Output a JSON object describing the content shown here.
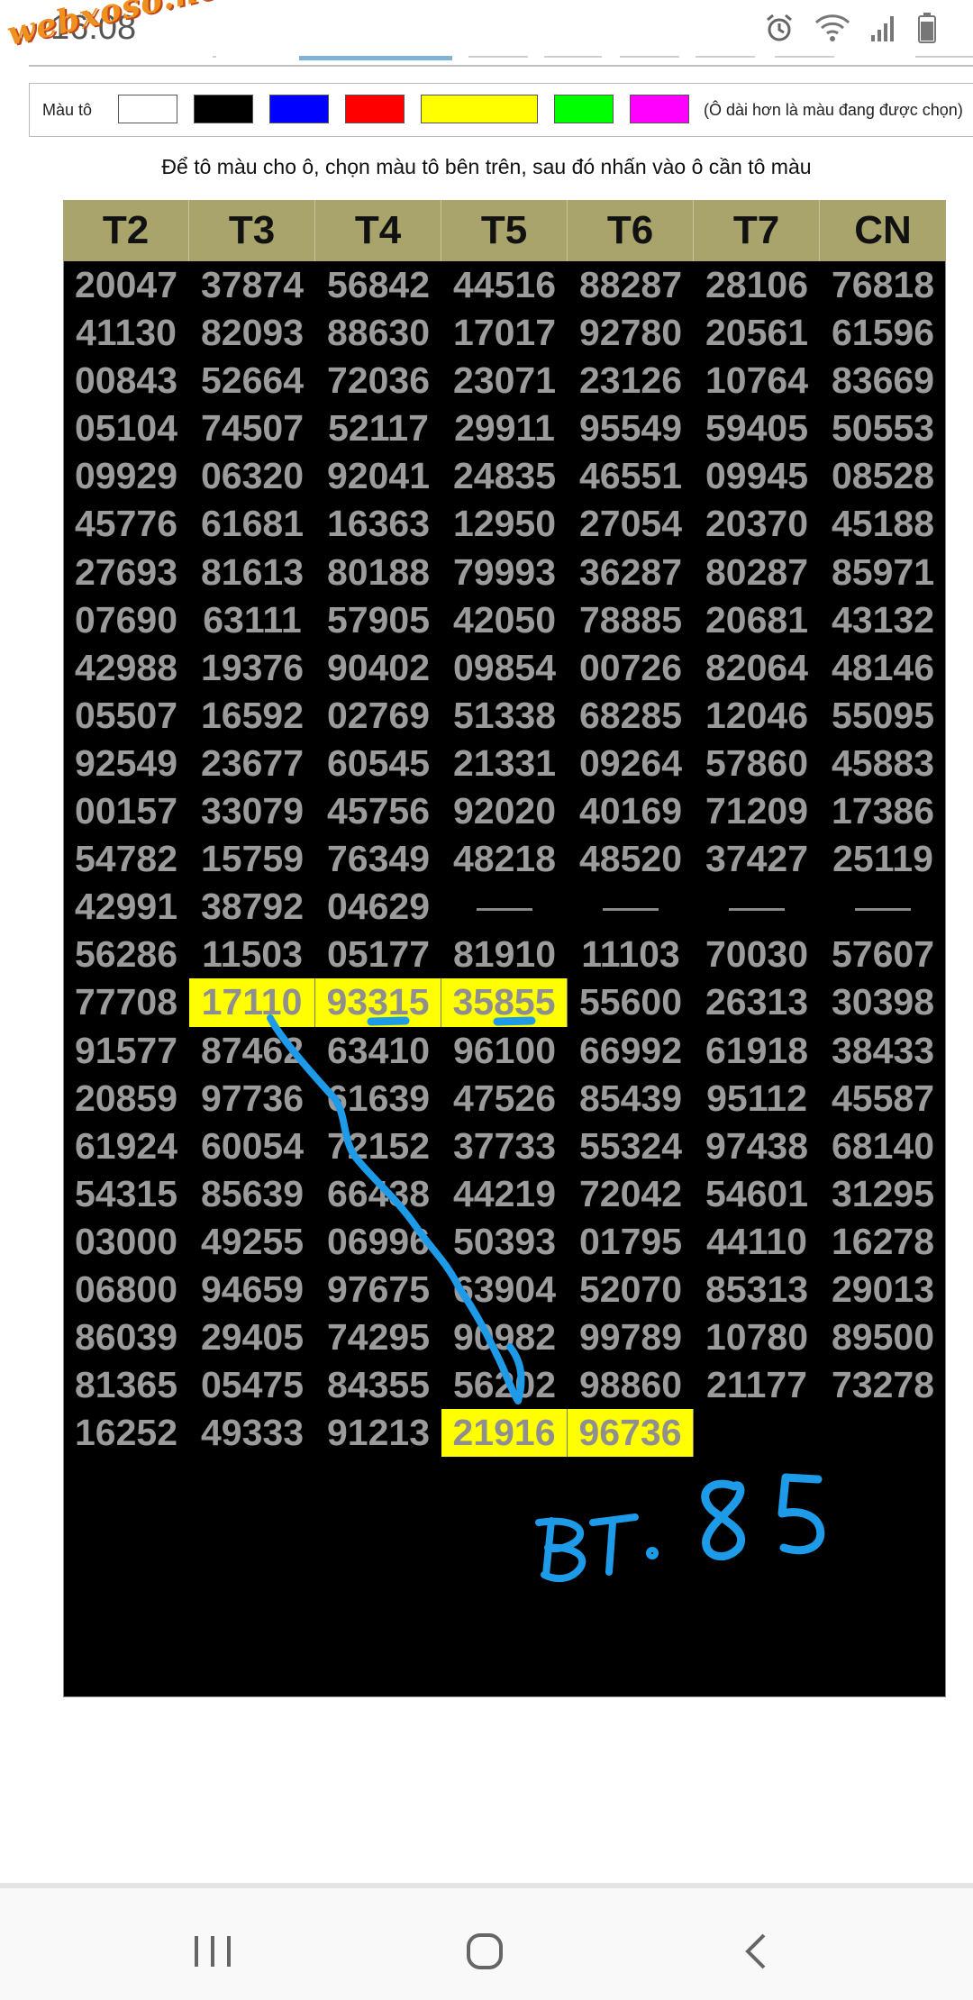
{
  "status_bar": {
    "time": "16:08",
    "watermark": "webxoso.net",
    "icons": [
      "alarm-icon",
      "wifi-icon",
      "signal-icon",
      "battery-icon"
    ]
  },
  "toolbar": {
    "label": "Màu tô",
    "swatches": [
      {
        "name": "white",
        "color": "#ffffff"
      },
      {
        "name": "black",
        "color": "#000000"
      },
      {
        "name": "blue",
        "color": "#0000ff"
      },
      {
        "name": "red",
        "color": "#ff0000"
      },
      {
        "name": "yellow",
        "color": "#ffff00",
        "selected": true
      },
      {
        "name": "green",
        "color": "#00ff00"
      },
      {
        "name": "magenta",
        "color": "#ff00ff"
      }
    ],
    "hint": "(Ô dài hơn là màu đang được chọn)"
  },
  "instruction": "Để tô màu cho ô, chọn màu tô bên trên, sau đó nhấn vào ô cần tô màu",
  "table": {
    "headers": [
      "T2",
      "T3",
      "T4",
      "T5",
      "T6",
      "T7",
      "CN"
    ],
    "rows": [
      [
        "20047",
        "37874",
        "56842",
        "44516",
        "88287",
        "28106",
        "76818"
      ],
      [
        "41130",
        "82093",
        "88630",
        "17017",
        "92780",
        "20561",
        "61596"
      ],
      [
        "00843",
        "52664",
        "72036",
        "23071",
        "23126",
        "10764",
        "83669"
      ],
      [
        "05104",
        "74507",
        "52117",
        "29911",
        "95549",
        "59405",
        "50553"
      ],
      [
        "09929",
        "06320",
        "92041",
        "24835",
        "46551",
        "09945",
        "08528"
      ],
      [
        "45776",
        "61681",
        "16363",
        "12950",
        "27054",
        "20370",
        "45188"
      ],
      [
        "27693",
        "81613",
        "80188",
        "79993",
        "36287",
        "80287",
        "85971"
      ],
      [
        "07690",
        "63111",
        "57905",
        "42050",
        "78885",
        "20681",
        "43132"
      ],
      [
        "42988",
        "19376",
        "90402",
        "09854",
        "00726",
        "82064",
        "48146"
      ],
      [
        "05507",
        "16592",
        "02769",
        "51338",
        "68285",
        "12046",
        "55095"
      ],
      [
        "92549",
        "23677",
        "60545",
        "21331",
        "09264",
        "57860",
        "45883"
      ],
      [
        "00157",
        "33079",
        "45756",
        "92020",
        "40169",
        "71209",
        "17386"
      ],
      [
        "54782",
        "15759",
        "76349",
        "48218",
        "48520",
        "37427",
        "25119"
      ],
      [
        "42991",
        "38792",
        "04629",
        "-",
        "-",
        "-",
        "-"
      ],
      [
        "56286",
        "11503",
        "05177",
        "81910",
        "11103",
        "70030",
        "57607"
      ],
      [
        "77708",
        "17110",
        "93315",
        "35855",
        "55600",
        "26313",
        "30398"
      ],
      [
        "91577",
        "87462",
        "63410",
        "96100",
        "66992",
        "61918",
        "38433"
      ],
      [
        "20859",
        "97736",
        "61639",
        "47526",
        "85439",
        "95112",
        "45587"
      ],
      [
        "61924",
        "60054",
        "72152",
        "37733",
        "55324",
        "97438",
        "68140"
      ],
      [
        "54315",
        "85639",
        "66438",
        "44219",
        "72042",
        "54601",
        "31295"
      ],
      [
        "03000",
        "49255",
        "06996",
        "50393",
        "01795",
        "44110",
        "16278"
      ],
      [
        "06800",
        "94659",
        "97675",
        "63904",
        "52070",
        "85313",
        "29013"
      ],
      [
        "86039",
        "29405",
        "74295",
        "90982",
        "99789",
        "10780",
        "89500"
      ],
      [
        "81365",
        "05475",
        "84355",
        "56202",
        "98860",
        "21177",
        "73278"
      ],
      [
        "16252",
        "49333",
        "91213",
        "21916",
        "96736",
        "",
        ""
      ]
    ],
    "highlighted": [
      [
        15,
        1
      ],
      [
        15,
        2
      ],
      [
        15,
        3
      ],
      [
        24,
        3
      ],
      [
        24,
        4
      ]
    ],
    "highlight_color": "#ffff00"
  },
  "annotation": {
    "text": "BT. 85",
    "ink_color": "#1e9be8"
  },
  "navbar": {
    "icons": [
      "recent-apps-icon",
      "home-icon",
      "back-icon"
    ]
  }
}
